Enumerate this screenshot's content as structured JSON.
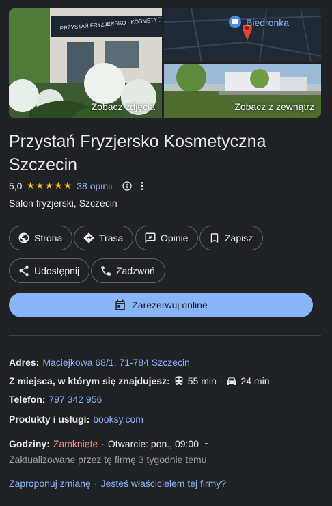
{
  "photos": {
    "main_caption": "Zobacz zdjęcia",
    "map_label": "Biedronka",
    "street_caption": "Zobacz z zewnątrz",
    "sign_text": "PRZYSTAŃ FRYZJERSKO - KOSMETYCZNA"
  },
  "business": {
    "name": "Przystań Fryzjersko Kosmetyczna Szczecin",
    "rating": "5,0",
    "reviews": "38 opinii",
    "category": "Salon fryzjerski, Szczecin"
  },
  "actions": {
    "website": "Strona",
    "directions": "Trasa",
    "reviews": "Opinie",
    "save": "Zapisz",
    "share": "Udostępnij",
    "call": "Zadzwoń",
    "book": "Zarezerwuj online"
  },
  "details": {
    "address_label": "Adres:",
    "address_value": "Maciejkowa 68/1, 71-784 Szczecin",
    "travel_label": "Z miejsca, w którym się znajdujesz:",
    "transit_time": "55 min",
    "car_time": "24 min",
    "phone_label": "Telefon:",
    "phone_value": "797 342 956",
    "products_label": "Produkty i usługi:",
    "products_value": "booksy.com",
    "hours_label": "Godziny:",
    "hours_status": "Zamknięte",
    "hours_next": "Otwarcie: pon., 09:00",
    "updated": "Zaktualizowane przez tę firmę 3 tygodnie temu",
    "suggest": "Zaproponuj zmianę",
    "owner": "Jesteś właścicielem tej firmy?"
  }
}
